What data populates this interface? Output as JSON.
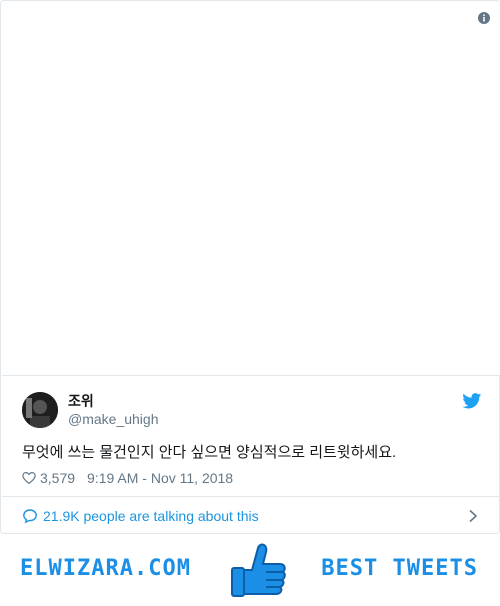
{
  "tweet": {
    "display_name": "조위",
    "handle": "@make_uhigh",
    "text": "무엇에 쓰는 물건인지 안다 싶으면 양심적으로 리트윗하세요.",
    "likes": "3,579",
    "timestamp": "9:19 AM - Nov 11, 2018"
  },
  "conversation": {
    "label": "21.9K people are talking about this"
  },
  "footer": {
    "left_text": "ELWIZARA.COM",
    "right_text": "BEST TWEETS"
  },
  "icons": {
    "info": "info-icon",
    "twitter": "twitter-bird-icon",
    "heart": "heart-icon",
    "reply": "reply-bubble-icon",
    "chevron": "chevron-right-icon",
    "thumb": "thumbs-up-icon"
  },
  "colors": {
    "accent": "#1b95e0",
    "text": "#14171a",
    "muted": "#657786",
    "border": "#e1e8ed",
    "footer_brand": "#1b8fe6"
  }
}
